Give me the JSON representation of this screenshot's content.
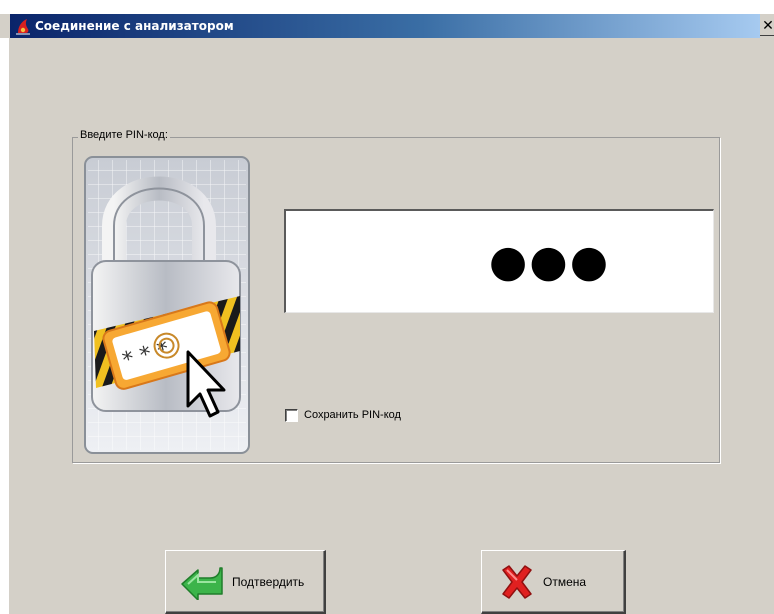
{
  "window": {
    "title": "Соединение с анализатором",
    "close_glyph": "✕"
  },
  "pin_group": {
    "legend": "Введите PIN-код:",
    "pin_masked": "●●●",
    "save_pin_label": "Сохранить PIN-код",
    "save_pin_checked": false
  },
  "buttons": {
    "confirm_label": "Подтвердить",
    "cancel_label": "Отмена"
  },
  "icons": {
    "app": "app-logo-icon",
    "lock": "padlock-pin-illustration",
    "confirm": "green-back-arrow-icon",
    "cancel": "red-x-icon"
  },
  "colors": {
    "window_bg": "#d4d0c8",
    "titlebar_start": "#0a246a",
    "titlebar_end": "#a6caf0",
    "confirm_icon": "#3cb44a",
    "cancel_icon": "#e02020"
  }
}
